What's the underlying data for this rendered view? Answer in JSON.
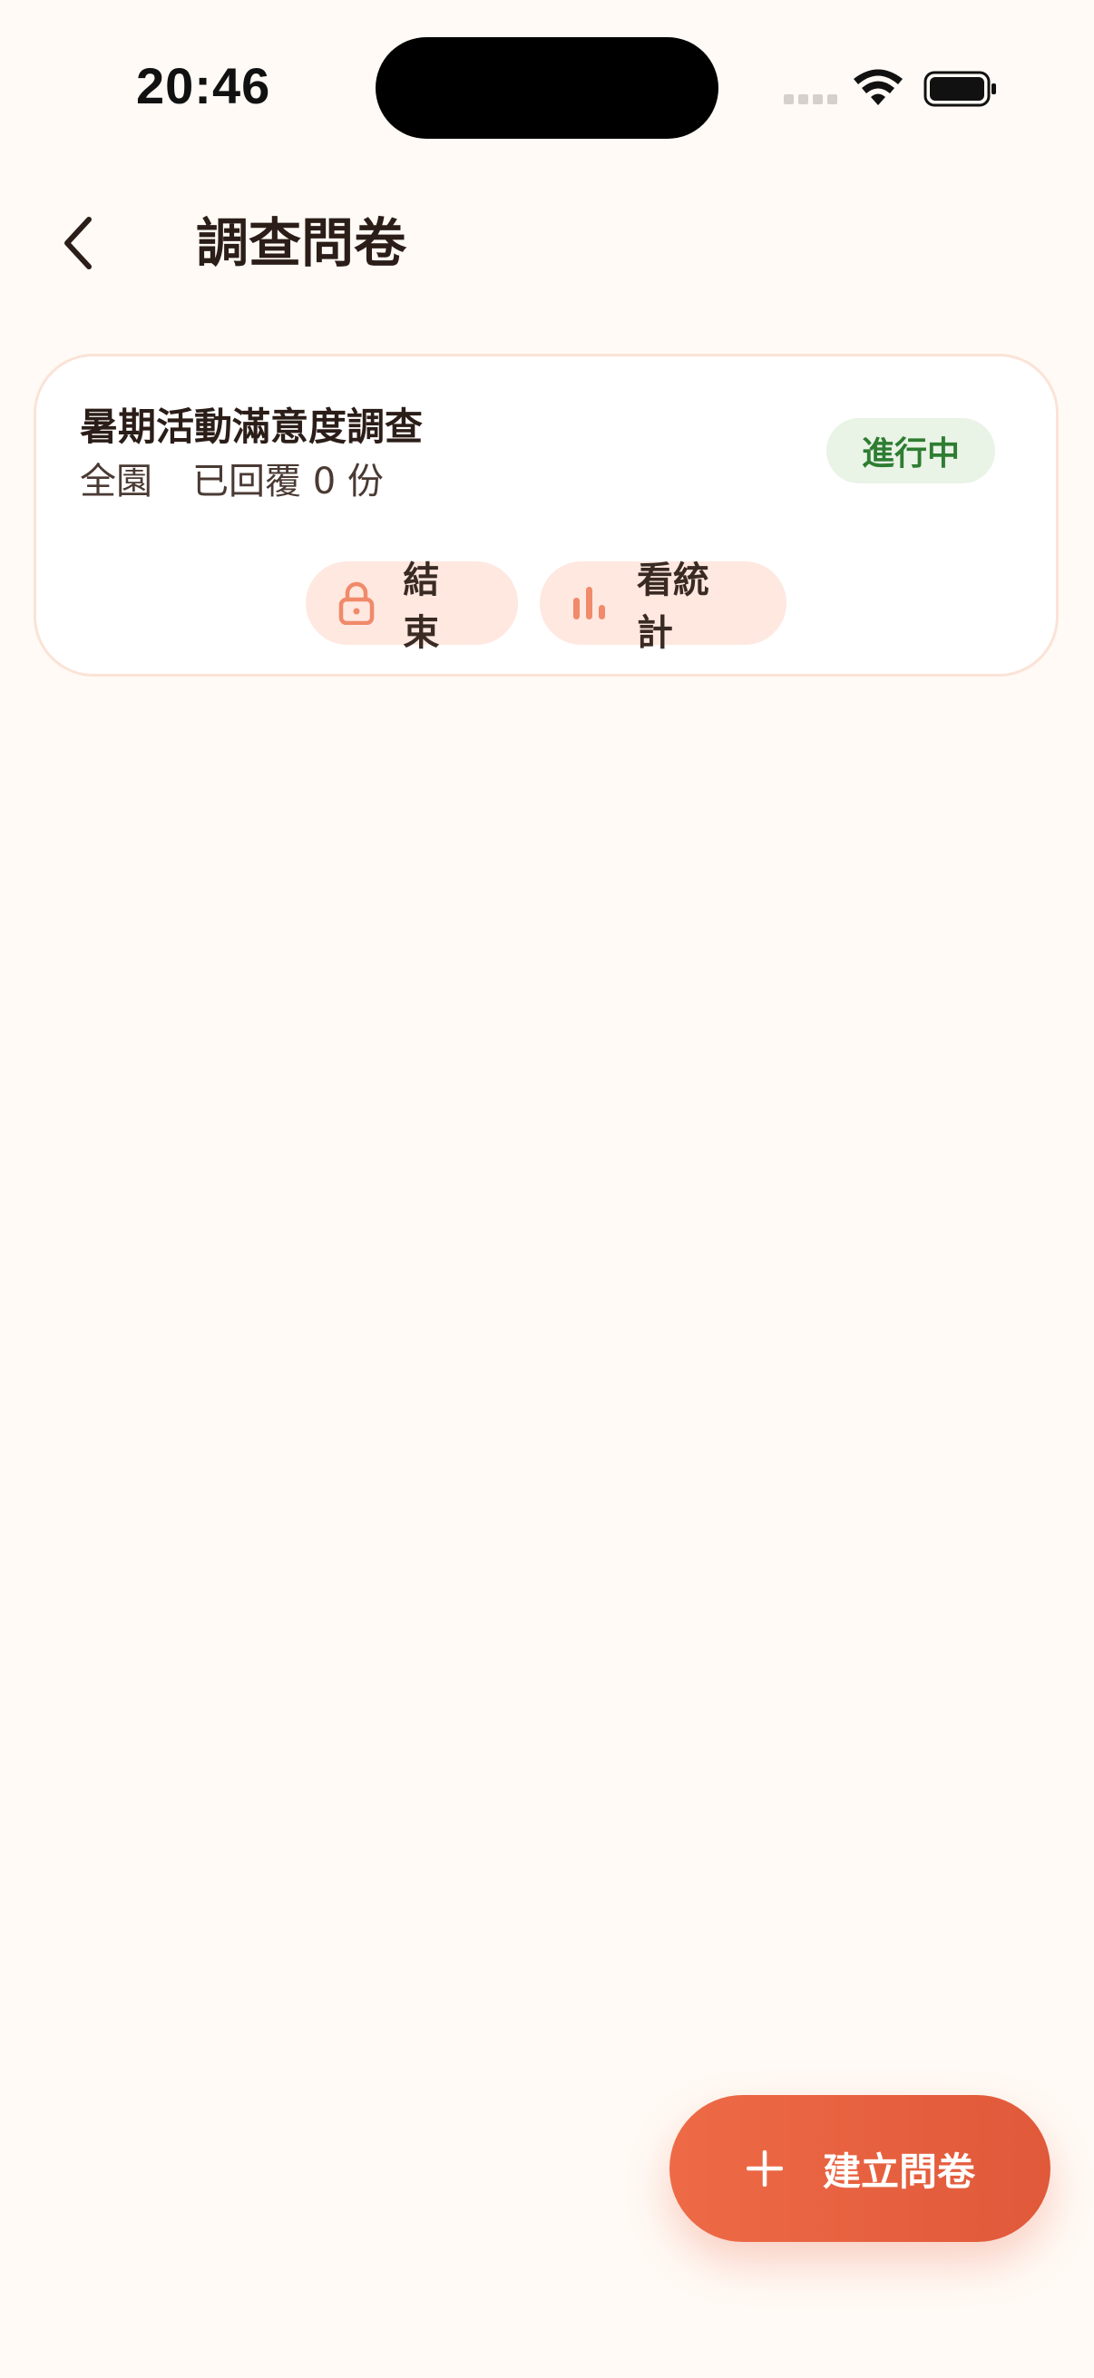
{
  "status_bar": {
    "time": "20:46"
  },
  "header": {
    "title": "調查問卷",
    "back_icon": "chevron-left-icon"
  },
  "surveys": [
    {
      "title": "暑期活動滿意度調查",
      "scope": "全園",
      "responses": "已回覆 0 份",
      "status": "進行中",
      "actions": {
        "end_label": "結束",
        "end_icon": "lock-icon",
        "stats_label": "看統計",
        "stats_icon": "bar-chart-icon"
      }
    }
  ],
  "fab": {
    "label": "建立問卷",
    "icon": "plus-icon"
  },
  "colors": {
    "background": "#FFFAF5",
    "accent": "#EE6A46",
    "badge_bg": "#E9F3E6",
    "badge_text": "#2E7D32",
    "pill_bg": "#FEE8E0"
  }
}
